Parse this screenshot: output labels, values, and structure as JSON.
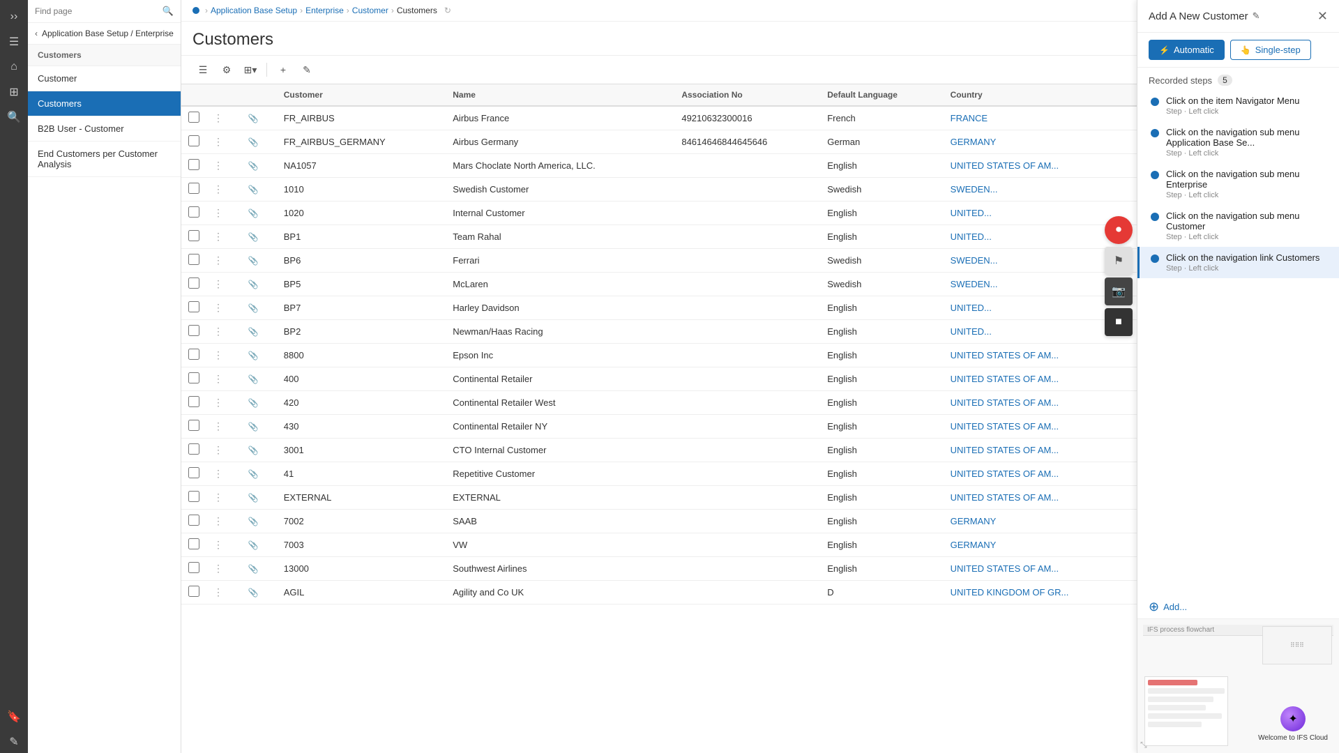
{
  "iconBar": {
    "icons": [
      "≡",
      "⌂",
      "⊞",
      "🔍"
    ]
  },
  "sidebar": {
    "searchPlaceholder": "Find page",
    "backLabel": "Application Base Setup / Enterprise",
    "sectionHeader": "Customers",
    "items": [
      {
        "id": "customers-link",
        "label": "Customer",
        "active": false
      },
      {
        "id": "customers-active",
        "label": "Customers",
        "active": true
      },
      {
        "id": "b2b-user",
        "label": "B2B User - Customer",
        "active": false
      },
      {
        "id": "end-customers",
        "label": "End Customers per Customer Analysis",
        "active": false
      }
    ]
  },
  "breadcrumb": {
    "items": [
      {
        "label": "Application Base Setup",
        "link": true
      },
      {
        "label": "Enterprise",
        "link": true
      },
      {
        "label": "Customer",
        "link": true
      },
      {
        "label": "Customers",
        "link": false
      }
    ]
  },
  "pageTitle": "Customers",
  "toolbar": {
    "buttons": [
      "☰",
      "⚙",
      "⊞▾",
      "+",
      "✎"
    ]
  },
  "table": {
    "columns": [
      "",
      "",
      "",
      "Customer",
      "Name",
      "Association No",
      "Default Language",
      "Country"
    ],
    "rows": [
      {
        "customer": "FR_AIRBUS",
        "name": "Airbus France",
        "assocNo": "49210632300016",
        "lang": "French",
        "country": "FRANCE"
      },
      {
        "customer": "FR_AIRBUS_GERMANY",
        "name": "Airbus Germany",
        "assocNo": "84614646844645646",
        "lang": "German",
        "country": "GERMANY"
      },
      {
        "customer": "NA1057",
        "name": "Mars Choclate North America, LLC.",
        "assocNo": "",
        "lang": "English",
        "country": "UNITED STATES OF AM..."
      },
      {
        "customer": "1010",
        "name": "Swedish Customer",
        "assocNo": "",
        "lang": "Swedish",
        "country": "SWEDEN..."
      },
      {
        "customer": "1020",
        "name": "Internal Customer",
        "assocNo": "",
        "lang": "English",
        "country": "UNITED..."
      },
      {
        "customer": "BP1",
        "name": "Team Rahal",
        "assocNo": "",
        "lang": "English",
        "country": "UNITED..."
      },
      {
        "customer": "BP6",
        "name": "Ferrari",
        "assocNo": "",
        "lang": "Swedish",
        "country": "SWEDEN..."
      },
      {
        "customer": "BP5",
        "name": "McLaren",
        "assocNo": "",
        "lang": "Swedish",
        "country": "SWEDEN..."
      },
      {
        "customer": "BP7",
        "name": "Harley Davidson",
        "assocNo": "",
        "lang": "English",
        "country": "UNITED..."
      },
      {
        "customer": "BP2",
        "name": "Newman/Haas Racing",
        "assocNo": "",
        "lang": "English",
        "country": "UNITED..."
      },
      {
        "customer": "8800",
        "name": "Epson Inc",
        "assocNo": "",
        "lang": "English",
        "country": "UNITED STATES OF AM..."
      },
      {
        "customer": "400",
        "name": "Continental Retailer",
        "assocNo": "",
        "lang": "English",
        "country": "UNITED STATES OF AM..."
      },
      {
        "customer": "420",
        "name": "Continental Retailer West",
        "assocNo": "",
        "lang": "English",
        "country": "UNITED STATES OF AM..."
      },
      {
        "customer": "430",
        "name": "Continental Retailer NY",
        "assocNo": "",
        "lang": "English",
        "country": "UNITED STATES OF AM..."
      },
      {
        "customer": "3001",
        "name": "CTO Internal Customer",
        "assocNo": "",
        "lang": "English",
        "country": "UNITED STATES OF AM..."
      },
      {
        "customer": "41",
        "name": "Repetitive Customer",
        "assocNo": "",
        "lang": "English",
        "country": "UNITED STATES OF AM..."
      },
      {
        "customer": "EXTERNAL",
        "name": "EXTERNAL",
        "assocNo": "",
        "lang": "English",
        "country": "UNITED STATES OF AM..."
      },
      {
        "customer": "7002",
        "name": "SAAB",
        "assocNo": "",
        "lang": "English",
        "country": "GERMANY"
      },
      {
        "customer": "7003",
        "name": "VW",
        "assocNo": "",
        "lang": "English",
        "country": "GERMANY"
      },
      {
        "customer": "13000",
        "name": "Southwest Airlines",
        "assocNo": "",
        "lang": "English",
        "country": "UNITED STATES OF AM..."
      },
      {
        "customer": "AGIL",
        "name": "Agility and Co UK",
        "assocNo": "",
        "lang": "D",
        "country": "UNITED KINGDOM OF GR..."
      }
    ]
  },
  "rightPanel": {
    "title": "Add A New Customer",
    "tabs": [
      {
        "id": "automatic",
        "label": "Automatic",
        "icon": "⚡",
        "active": true
      },
      {
        "id": "single-step",
        "label": "Single-step",
        "icon": "👆",
        "active": false
      }
    ],
    "recordedLabel": "Recorded steps",
    "recordedCount": "5",
    "steps": [
      {
        "id": "step1",
        "title": "Click on the item Navigator Menu",
        "sub": "Step · Left click",
        "active": false
      },
      {
        "id": "step2",
        "title": "Click on the navigation sub menu Application Base Se...",
        "sub": "Step · Left click",
        "active": false
      },
      {
        "id": "step3",
        "title": "Click on the navigation sub menu Enterprise",
        "sub": "Step · Left click",
        "active": false
      },
      {
        "id": "step4",
        "title": "Click on the navigation sub menu Customer",
        "sub": "Step · Left click",
        "active": false
      },
      {
        "id": "step5",
        "title": "Click on the navigation link Customers",
        "sub": "Step · Left click",
        "active": true
      }
    ],
    "addLabel": "Add...",
    "welcomeText": "Welcome to IFS Cloud"
  },
  "floatButtons": [
    {
      "id": "record",
      "icon": "⏺",
      "color": "red"
    },
    {
      "id": "flag",
      "icon": "⚑",
      "color": "gray"
    },
    {
      "id": "camera",
      "icon": "📷",
      "color": "dark"
    },
    {
      "id": "stop",
      "icon": "■",
      "color": "dark"
    }
  ]
}
